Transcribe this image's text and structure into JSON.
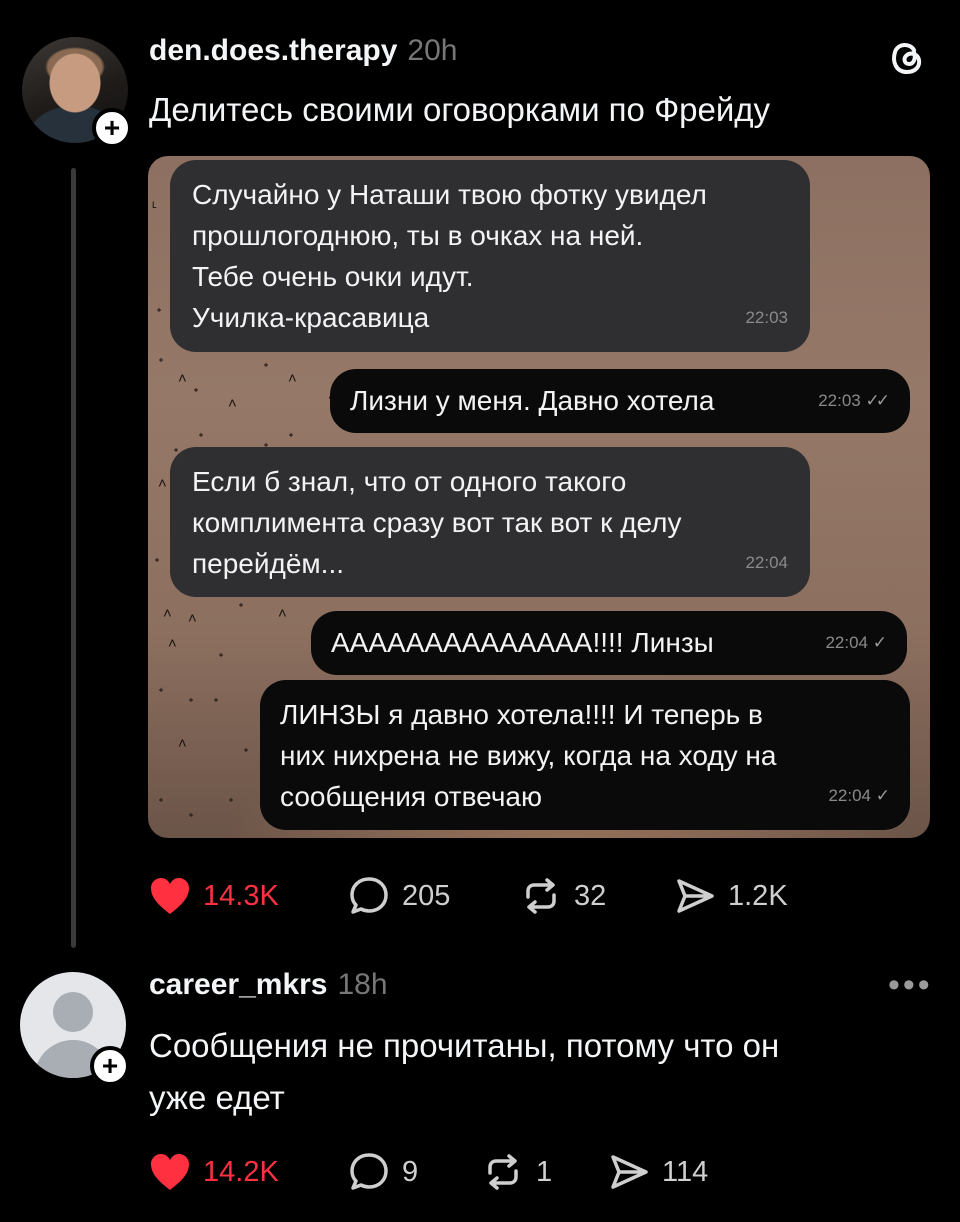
{
  "post1": {
    "username": "den.does.therapy",
    "time": "20h",
    "text": "Делитесь своими оговорками по Фрейду",
    "messages": [
      {
        "lines": [
          "Случайно у Наташи твою фотку увидел",
          "прошлогоднюю, ты в очках на ней.",
          "Тебе очень очки идут.",
          "Училка-красавица"
        ],
        "time": "22:03",
        "dir": "in"
      },
      {
        "lines": [
          "Лизни у меня. Давно хотела"
        ],
        "time": "22:03",
        "dir": "out"
      },
      {
        "lines": [
          "Если б знал, что от одного такого",
          "комплимента сразу вот так вот к делу",
          "перейдём..."
        ],
        "time": "22:04",
        "dir": "in"
      },
      {
        "lines": [
          "АААААААААААААА!!!! Линзы"
        ],
        "time": "22:04",
        "dir": "out"
      },
      {
        "lines": [
          "ЛИНЗЫ я давно хотела!!!! И теперь в",
          "них нихрена не вижу, когда на ходу на",
          "сообщения отвечаю"
        ],
        "time": "22:04",
        "dir": "out"
      }
    ],
    "likes": "14.3K",
    "replies": "205",
    "reposts": "32",
    "shares": "1.2K"
  },
  "post2": {
    "username": "career_mkrs",
    "time": "18h",
    "text_lines": [
      "Сообщения не прочитаны, потому что он",
      "уже едет"
    ],
    "likes": "14.2K",
    "replies": "9",
    "reposts": "1",
    "shares": "114"
  },
  "colors": {
    "like": "#ff3040",
    "background": "#000000"
  },
  "icons": [
    "threads-logo-icon",
    "plus-icon",
    "heart-icon",
    "comment-icon",
    "repost-icon",
    "share-icon",
    "more-icon"
  ]
}
